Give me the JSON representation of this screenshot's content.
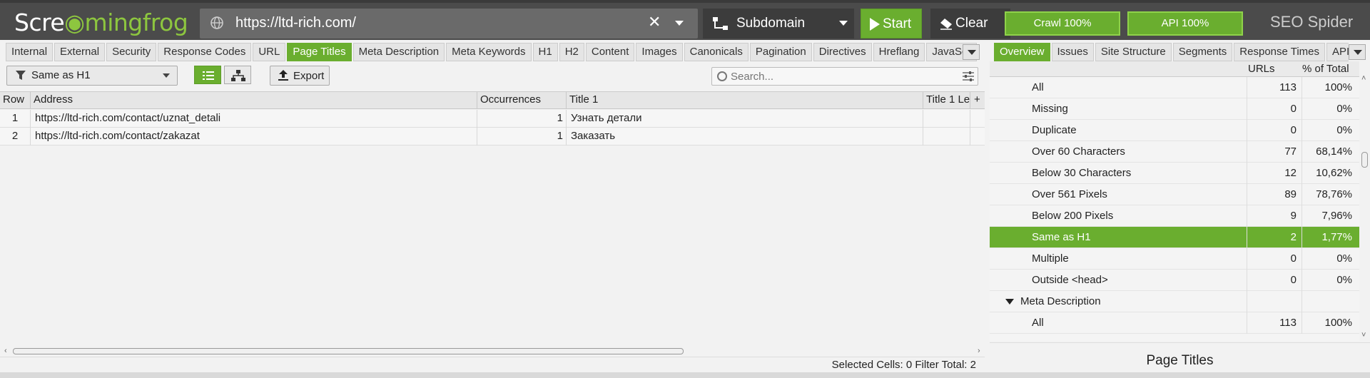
{
  "app": {
    "logo_prefix": "Scre",
    "logo_frog": "mingfrog",
    "logo_suffix": "",
    "product": "SEO Spider"
  },
  "toolbar": {
    "url": "https://ltd-rich.com/",
    "mode": "Subdomain",
    "start_label": "Start",
    "clear_label": "Clear",
    "crawl_progress": "Crawl 100%",
    "api_progress": "API 100%"
  },
  "tabs_left": [
    "Internal",
    "External",
    "Security",
    "Response Codes",
    "URL",
    "Page Titles",
    "Meta Description",
    "Meta Keywords",
    "H1",
    "H2",
    "Content",
    "Images",
    "Canonicals",
    "Pagination",
    "Directives",
    "Hreflang",
    "JavaScr"
  ],
  "tabs_left_active": "Page Titles",
  "tabs_right": [
    "Overview",
    "Issues",
    "Site Structure",
    "Segments",
    "Response Times",
    "API"
  ],
  "tabs_right_active": "Overview",
  "filter": {
    "selected": "Same as H1",
    "export_label": "Export",
    "search_placeholder": "Search..."
  },
  "grid": {
    "columns": [
      "Row",
      "Address",
      "Occurrences",
      "Title 1",
      "Title 1 Le"
    ],
    "rows": [
      {
        "row": "1",
        "address": "https://ltd-rich.com/contact/uznat_detali",
        "occurrences": "1",
        "title1": "Узнать детали"
      },
      {
        "row": "2",
        "address": "https://ltd-rich.com/contact/zakazat",
        "occurrences": "1",
        "title1": "Заказать"
      }
    ]
  },
  "status": {
    "text": "Selected Cells:  0  Filter Total:  2"
  },
  "overview": {
    "col_urls": "URLs",
    "col_pct": "% of Total",
    "rows": [
      {
        "label": "All",
        "urls": "113",
        "pct": "100%"
      },
      {
        "label": "Missing",
        "urls": "0",
        "pct": "0%"
      },
      {
        "label": "Duplicate",
        "urls": "0",
        "pct": "0%"
      },
      {
        "label": "Over 60 Characters",
        "urls": "77",
        "pct": "68,14%"
      },
      {
        "label": "Below 30 Characters",
        "urls": "12",
        "pct": "10,62%"
      },
      {
        "label": "Over 561 Pixels",
        "urls": "89",
        "pct": "78,76%"
      },
      {
        "label": "Below 200 Pixels",
        "urls": "9",
        "pct": "7,96%"
      },
      {
        "label": "Same as H1",
        "urls": "2",
        "pct": "1,77%"
      },
      {
        "label": "Multiple",
        "urls": "0",
        "pct": "0%"
      },
      {
        "label": "Outside <head>",
        "urls": "0",
        "pct": "0%"
      },
      {
        "label": "Meta Description",
        "urls": "",
        "pct": ""
      },
      {
        "label": "All",
        "urls": "113",
        "pct": "100%"
      }
    ],
    "selected_index": 7,
    "group_index": 10,
    "footer_title": "Page Titles"
  },
  "colors": {
    "accent_green": "#6aae2f",
    "topbar": "#4b4b4b"
  }
}
